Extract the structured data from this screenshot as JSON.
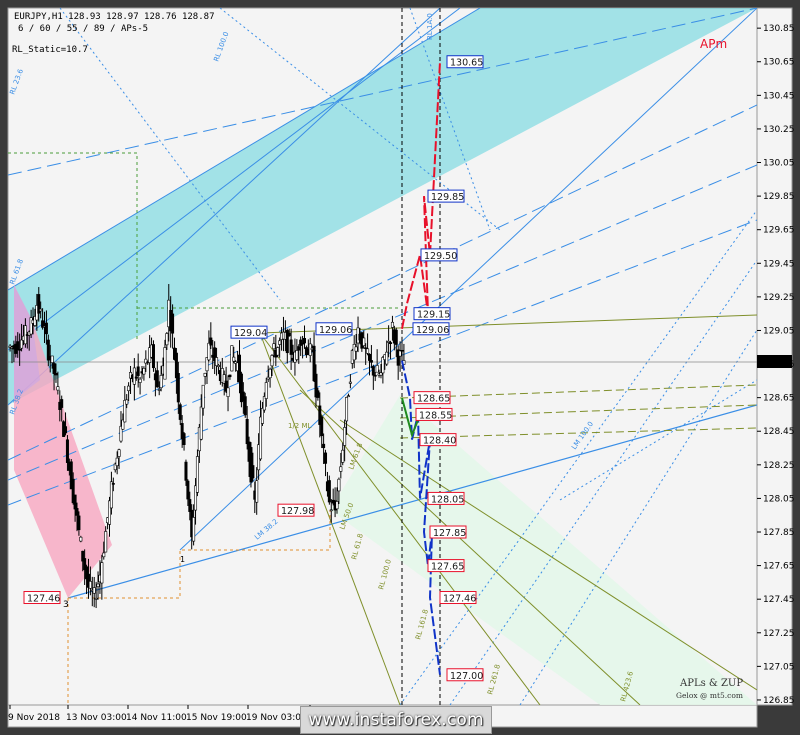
{
  "header": {
    "symbol_line": "EURJPY,H1  128.93 128.97 128.76 128.87",
    "params_line": "6 / 60 / 55 / 89 / APs-5",
    "static_line": "RL_Static=10.7"
  },
  "corner_label": "APm",
  "signature": {
    "line1": "APLs & ZUP",
    "line2": "Gelox @ mt5.com"
  },
  "watermark": "www.instaforex.com",
  "current_price": "128.87",
  "pivot_label": "3",
  "pivot_label_b": "1",
  "fib_labels": [
    "RL 23.6",
    "RL 61.8",
    "RL 38.2",
    "LM 100.0",
    "LM 38.2",
    "RL 61.8",
    "RL 100.0",
    "RL 161.8",
    "RL 261.8",
    "RL 423.6",
    "1/2 ML",
    "LM 61.8",
    "LM 50.0",
    "RL 100.0",
    "RL 1A.0"
  ],
  "colors": {
    "background": "#f4f4f4",
    "blue_channel": "#5fd3dd",
    "pink_channel": "#f7a6c0",
    "green_channel": "#e4f7ea",
    "red_projection": "#e8102a",
    "blue_projection": "#1033c8",
    "green_projection": "#1f8a1f",
    "blue_line": "#3a8ee6",
    "olive_line": "#7f8f2a"
  },
  "chart_data": {
    "type": "candlestick",
    "symbol": "EURJPY",
    "timeframe": "H1",
    "ohlc_header": {
      "open": 128.93,
      "high": 128.97,
      "low": 128.76,
      "close": 128.87
    },
    "y_ticks": [
      130.85,
      130.65,
      130.45,
      130.25,
      130.05,
      129.85,
      129.65,
      129.45,
      129.25,
      129.05,
      128.85,
      128.65,
      128.45,
      128.25,
      128.05,
      127.85,
      127.65,
      127.45,
      127.25,
      127.05,
      126.85
    ],
    "ylim": [
      126.82,
      130.97
    ],
    "x_ticks": [
      "9 Nov 2018",
      "13 Nov 03:00",
      "14 Nov 11:00",
      "15 Nov 19:00",
      "19 Nov 03:00",
      "20"
    ],
    "series": [
      {
        "values": [
          128.95,
          128.99,
          129.02,
          129.08,
          129.21,
          129.1,
          128.93,
          128.8,
          128.62,
          128.4,
          128.15,
          127.92,
          127.7,
          127.52,
          127.46,
          127.6,
          127.85,
          128.1,
          128.32,
          128.55,
          128.72,
          128.8,
          128.75,
          128.85,
          128.92,
          128.7,
          128.82,
          129.21,
          128.9,
          128.55,
          128.2,
          127.8,
          128.3,
          128.75,
          128.95,
          128.88,
          128.8,
          128.7,
          128.9,
          128.85,
          128.6,
          128.3,
          128.02,
          128.5,
          128.78,
          128.9,
          128.95,
          129.01,
          128.96,
          128.88,
          129.02,
          128.95,
          128.9,
          128.6,
          128.3,
          128.02,
          127.98,
          128.25,
          128.6,
          128.9,
          129.06,
          128.95,
          128.85,
          128.8,
          128.78,
          128.95,
          129.06,
          128.9,
          128.87
        ]
      }
    ],
    "level_labels": [
      {
        "value": "130.65",
        "color": "blue"
      },
      {
        "value": "129.85",
        "color": "blue"
      },
      {
        "value": "129.50",
        "color": "blue"
      },
      {
        "value": "129.15",
        "color": "blue"
      },
      {
        "value": "129.06",
        "color": "blue"
      },
      {
        "value": "129.04",
        "color": "blue"
      },
      {
        "value": "129.06",
        "color": "blue"
      },
      {
        "value": "128.65",
        "color": "red"
      },
      {
        "value": "128.55",
        "color": "red"
      },
      {
        "value": "128.40",
        "color": "red"
      },
      {
        "value": "128.05",
        "color": "red"
      },
      {
        "value": "127.98",
        "color": "red"
      },
      {
        "value": "127.85",
        "color": "red"
      },
      {
        "value": "127.65",
        "color": "red"
      },
      {
        "value": "127.46",
        "color": "red"
      },
      {
        "value": "127.46",
        "color": "red"
      },
      {
        "value": "127.00",
        "color": "red"
      }
    ],
    "projections": {
      "up_path": [
        129.06,
        129.21,
        129.5,
        129.15,
        129.85,
        129.5,
        130.65
      ],
      "down_path": [
        128.87,
        128.65,
        128.4,
        128.55,
        128.05,
        128.4,
        127.85,
        127.65,
        127.85,
        127.46,
        127.0
      ]
    },
    "grid": false,
    "legend": "none"
  }
}
